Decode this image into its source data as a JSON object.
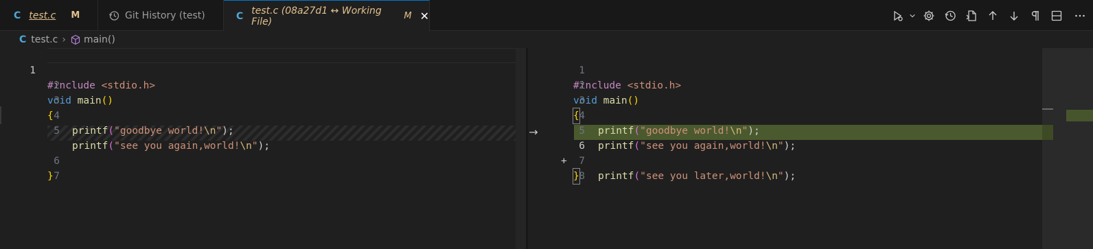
{
  "tabs": [
    {
      "lang": "C",
      "name": "test.c",
      "status": "M"
    },
    {
      "name": "Git History (test)"
    },
    {
      "lang": "C",
      "name": "test.c (08a27d1 ↔ Working File)",
      "status": "M",
      "close": "✕"
    }
  ],
  "actions": [
    "run-debug-icon",
    "chevron-down-icon",
    "gear-icon",
    "history-icon",
    "open-file-icon",
    "arrow-up-icon",
    "arrow-down-icon",
    "pilcrow-icon",
    "split-layout-icon",
    "more-icon"
  ],
  "breadcrumb": {
    "lang": "C",
    "file": "test.c",
    "symbol": "main()"
  },
  "left": {
    "numbers": [
      "1",
      "2",
      "3",
      "4",
      "5",
      "6",
      "7"
    ]
  },
  "right": {
    "numbers": [
      "1",
      "2",
      "3",
      "4",
      "5",
      "6",
      "7",
      "8"
    ],
    "added_marker": "+"
  },
  "code": {
    "include_kw": "#include",
    "include_file": "<stdio.h>",
    "void_kw": "void",
    "main_fn": "main",
    "parens": "()",
    "open_brace": "{",
    "close_brace": "}",
    "printf": "printf",
    "str1": "\"goodbye world!",
    "str2": "\"see you again,world!",
    "str3": "\"see you later,world!",
    "esc": "\\n",
    "quote": "\"",
    "tail": ");",
    "paren_open": "("
  },
  "revert_arrow": "→",
  "colors": {
    "added_line": "#4b5a2e",
    "accent": "#0078d4",
    "modified": "#e2c08d"
  }
}
